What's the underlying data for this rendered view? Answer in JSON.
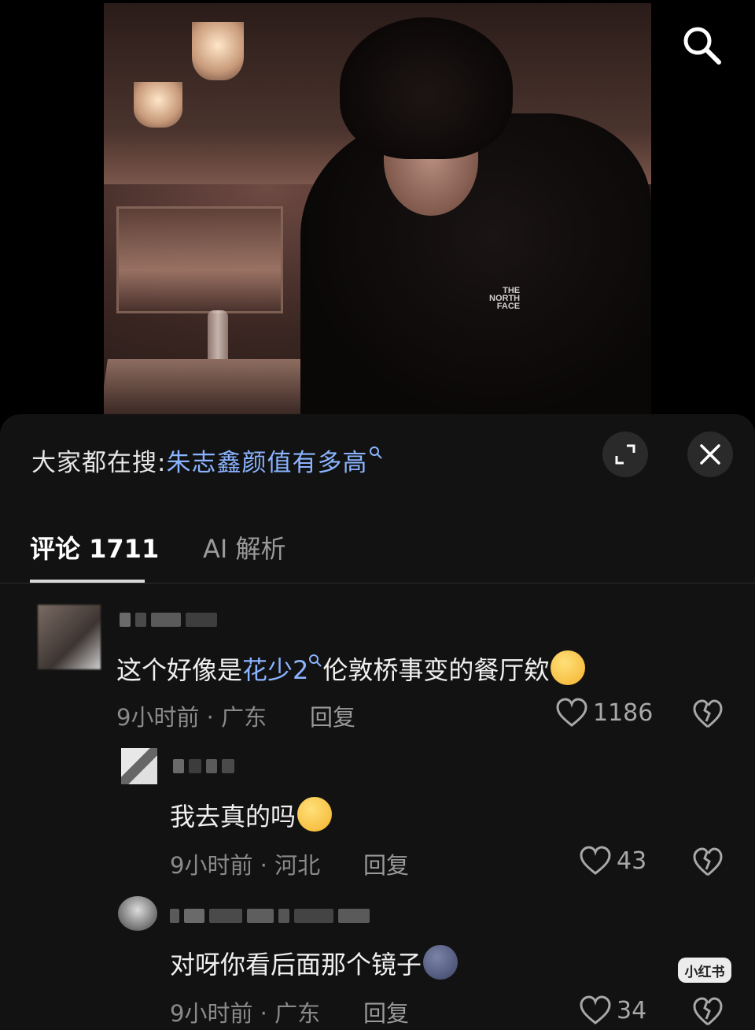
{
  "video": {
    "brand_text_line1": "THE",
    "brand_text_line2": "NORTH",
    "brand_text_line3": "FACE"
  },
  "header": {
    "trending_label": "大家都在搜:",
    "trending_keyword": "朱志鑫颜值有多高",
    "search_icon": "search-icon",
    "expand_icon": "expand-icon",
    "close_icon": "close-icon"
  },
  "tabs": [
    {
      "label": "评论 1711",
      "active": true
    },
    {
      "label": "AI 解析",
      "active": false
    }
  ],
  "comments": [
    {
      "text_before": "这个好像是",
      "link": "花少2",
      "text_after": "伦敦桥事变的餐厅欸",
      "emoji": "crying-face-emoji",
      "time": "9小时前",
      "location": "广东",
      "reply_label": "回复",
      "likes": "1186"
    },
    {
      "text": "我去真的吗",
      "emoji": "pleading-face-emoji",
      "time": "9小时前",
      "location": "河北",
      "reply_label": "回复",
      "likes": "43"
    },
    {
      "text": "对呀你看后面那个镜子",
      "emoji": "new-moon-face-emoji",
      "time": "9小时前",
      "location": "广东",
      "reply_label": "回复",
      "likes": "34"
    }
  ],
  "meta_separator": "·",
  "watermark": "小红书",
  "colors": {
    "panel_bg": "#121212",
    "link": "#8ab4ff",
    "meta": "#8a8a8a"
  }
}
